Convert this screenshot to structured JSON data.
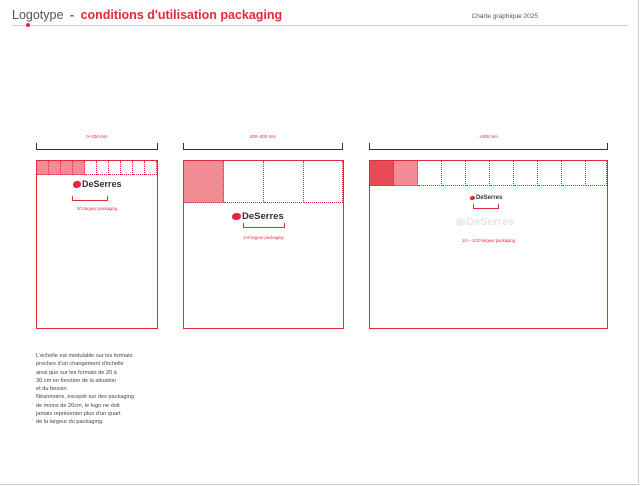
{
  "header": {
    "title_plain": "Logotype",
    "title_sep": "-",
    "title_accent": "conditions d'utilisation packaging",
    "right_label": "Charte graphique 2025"
  },
  "panels": [
    {
      "bracket_label": "0–200 mm",
      "logo_text": "DeSerres",
      "size_label": "3/3 largeur packaging"
    },
    {
      "bracket_label": "200–300 mm",
      "logo_text": "DeSerres",
      "size_label": "1/4 largeur packaging"
    },
    {
      "bracket_label": "+300 mm",
      "logo_text": "DeSerres",
      "ghost_logo_text": "DeSerres",
      "size_label": "1/4 – 1/10 largeur packaging"
    }
  ],
  "body_lines": [
    "L'échelle est modulable sur les formats",
    "proches d'un changement d'échelle",
    "ainsi que sur les formats de 20 à",
    "30 cm en fonction de la situation",
    "et du besoin.",
    "Néanmoins, excepté sur des packaging",
    "de moins de 20cm, le logo ne doit",
    "jamais représenter plus d'un quart",
    "de la largeur du packaging."
  ],
  "colors": {
    "accent": "#e22a3a",
    "fill_dark": "#e84a57",
    "fill_light": "#f28c94",
    "rule": "#cfcfcf"
  }
}
